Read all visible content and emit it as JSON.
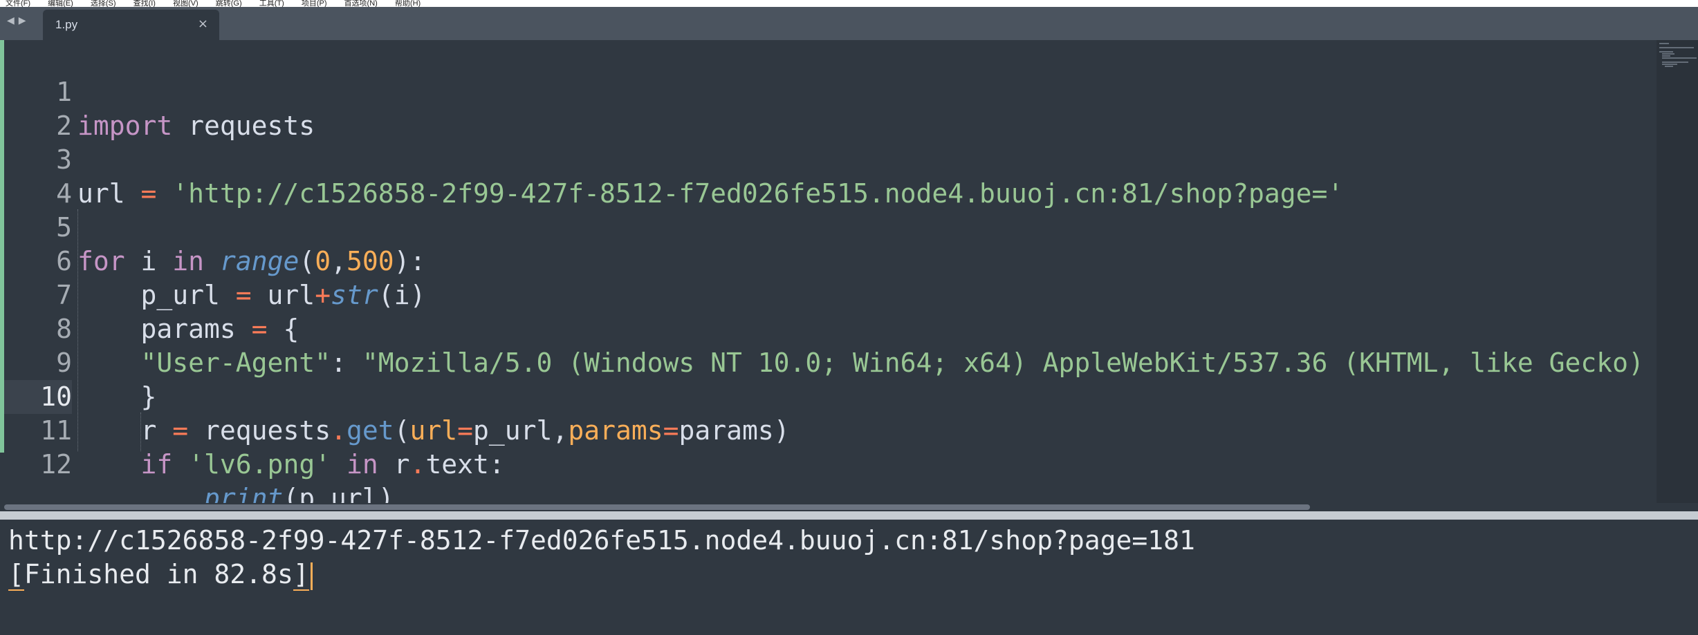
{
  "menubar": {
    "items": [
      "文件(F)",
      "编辑(E)",
      "选择(S)",
      "查找(I)",
      "视图(V)",
      "跳转(G)",
      "工具(T)",
      "项目(P)",
      "首选项(N)",
      "帮助(H)"
    ]
  },
  "tabs": [
    {
      "label": "1.py",
      "close_glyph": "×"
    }
  ],
  "nav": {
    "back_glyph": "◀",
    "forward_glyph": "▶"
  },
  "editor": {
    "language": "python",
    "current_line": 10,
    "lines": [
      {
        "n": "1",
        "text": "import requests"
      },
      {
        "n": "2",
        "text": ""
      },
      {
        "n": "3",
        "text": "url = 'http://c1526858-2f99-427f-8512-f7ed026fe515.node4.buuoj.cn:81/shop?page='"
      },
      {
        "n": "4",
        "text": ""
      },
      {
        "n": "5",
        "text": "for i in range(0,500):"
      },
      {
        "n": "6",
        "text": "    p_url = url+str(i)"
      },
      {
        "n": "7",
        "text": "    params = {"
      },
      {
        "n": "8",
        "text": "    \"User-Agent\": \"Mozilla/5.0 (Windows NT 10.0; Win64; x64) AppleWebKit/537.36 (KHTML, like Gecko)"
      },
      {
        "n": "9",
        "text": "    }"
      },
      {
        "n": "10",
        "text": "    r = requests.get(url=p_url,params=params)"
      },
      {
        "n": "11",
        "text": "    if 'lv6.png' in r.text:"
      },
      {
        "n": "12",
        "text": "        print(p_url)"
      }
    ],
    "tokens": {
      "l1_kw": "import",
      "l1_rest": " requests",
      "l3_var": "url ",
      "l3_op": "=",
      "l3_str": " 'http://c1526858-2f99-427f-8512-f7ed026fe515.node4.buuoj.cn:81/shop?page='",
      "l5_for": "for",
      "l5_i": " i ",
      "l5_in": "in",
      "l5_sp": " ",
      "l5_range": "range",
      "l5_p1": "(",
      "l5_n0": "0",
      "l5_c": ",",
      "l5_n500": "500",
      "l5_p2": "):",
      "l6_a": "    p_url ",
      "l6_op": "=",
      "l6_b": " url",
      "l6_plus": "+",
      "l6_str": "str",
      "l6_c": "(i)",
      "l7_a": "    params ",
      "l7_op": "=",
      "l7_b": " {",
      "l8_indent": "    ",
      "l8_key": "\"User-Agent\"",
      "l8_colon": ": ",
      "l8_val": "\"Mozilla/5.0 (Windows NT 10.0; Win64; x64) AppleWebKit/537.36 (KHTML, like Gecko)",
      "l9": "    }",
      "l10_a": "    r ",
      "l10_op": "=",
      "l10_b": " requests",
      "l10_dot": ".",
      "l10_get": "get",
      "l10_p": "(",
      "l10_url": "url",
      "l10_eq1": "=",
      "l10_purl": "p_url,",
      "l10_params": "params",
      "l10_eq2": "=",
      "l10_end": "params)",
      "l11_indent": "    ",
      "l11_if": "if",
      "l11_sp": " ",
      "l11_str": "'lv6.png'",
      "l11_sp2": " ",
      "l11_in": "in",
      "l11_r": " r",
      "l11_dot": ".",
      "l11_text": "text:",
      "l12_indent": "        ",
      "l12_print": "print",
      "l12_rest": "(p_url)"
    }
  },
  "output": {
    "line1": "http://c1526858-2f99-427f-8512-f7ed026fe515.node4.buuoj.cn:81/shop?page=181",
    "line2_bracket_open": "[",
    "line2_text": "Finished in 82.8s",
    "line2_bracket_close": "]"
  },
  "colors": {
    "background": "#303841",
    "keyword": "#c695c6",
    "string": "#99c794",
    "function": "#6699cc",
    "number": "#f9ae58",
    "operator": "#f97b58",
    "gutter_modified": "#80c49a"
  }
}
